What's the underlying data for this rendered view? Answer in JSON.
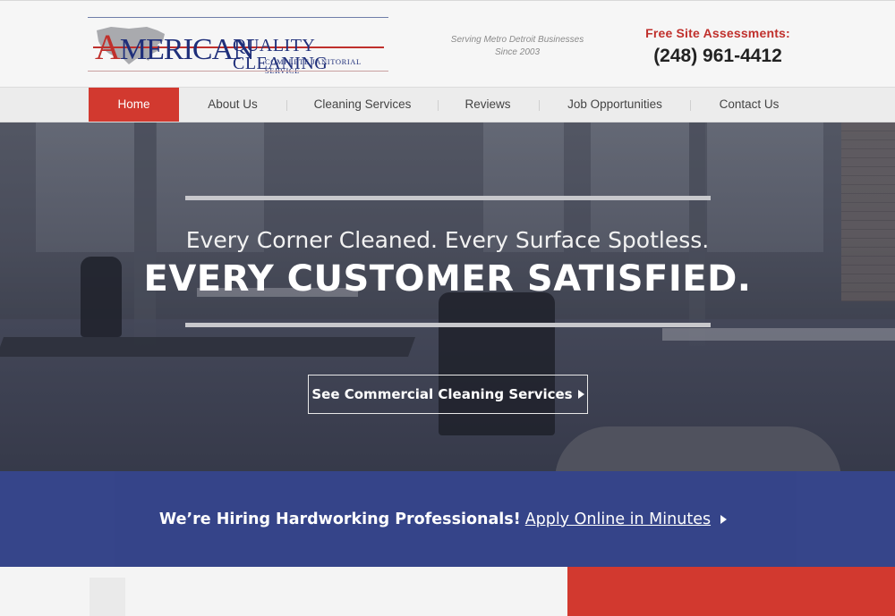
{
  "brand": {
    "logo_word_main": "MERICAN",
    "logo_word_initial": "A",
    "logo_word_second": "QUALITY CLEANING",
    "logo_tagline": "COMPLETE JANITORIAL SERVICE",
    "service_area": "Serving Metro Detroit Businesses",
    "since": "Since 2003"
  },
  "contact": {
    "assessment_label": "Free Site Assessments:",
    "phone": "(248) 961-4412"
  },
  "nav": {
    "items": [
      {
        "label": "Home",
        "active": true
      },
      {
        "label": "About Us",
        "active": false
      },
      {
        "label": "Cleaning Services",
        "active": false
      },
      {
        "label": "Reviews",
        "active": false
      },
      {
        "label": "Job Opportunities",
        "active": false
      },
      {
        "label": "Contact Us",
        "active": false
      }
    ]
  },
  "hero": {
    "line1": "Every Corner Cleaned. Every Surface Spotless.",
    "line2": "EVERY CUSTOMER SATISFIED.",
    "cta_label": "See Commercial Cleaning Services",
    "cta_icon": "triangle-right-icon"
  },
  "hiring": {
    "headline": "We’re Hiring Hardworking Professionals!",
    "link_label": "Apply Online in Minutes",
    "icon": "triangle-right-icon"
  },
  "colors": {
    "accent_red": "#d2392f",
    "brand_navy": "#2f3f86",
    "text_dark": "#222222"
  }
}
